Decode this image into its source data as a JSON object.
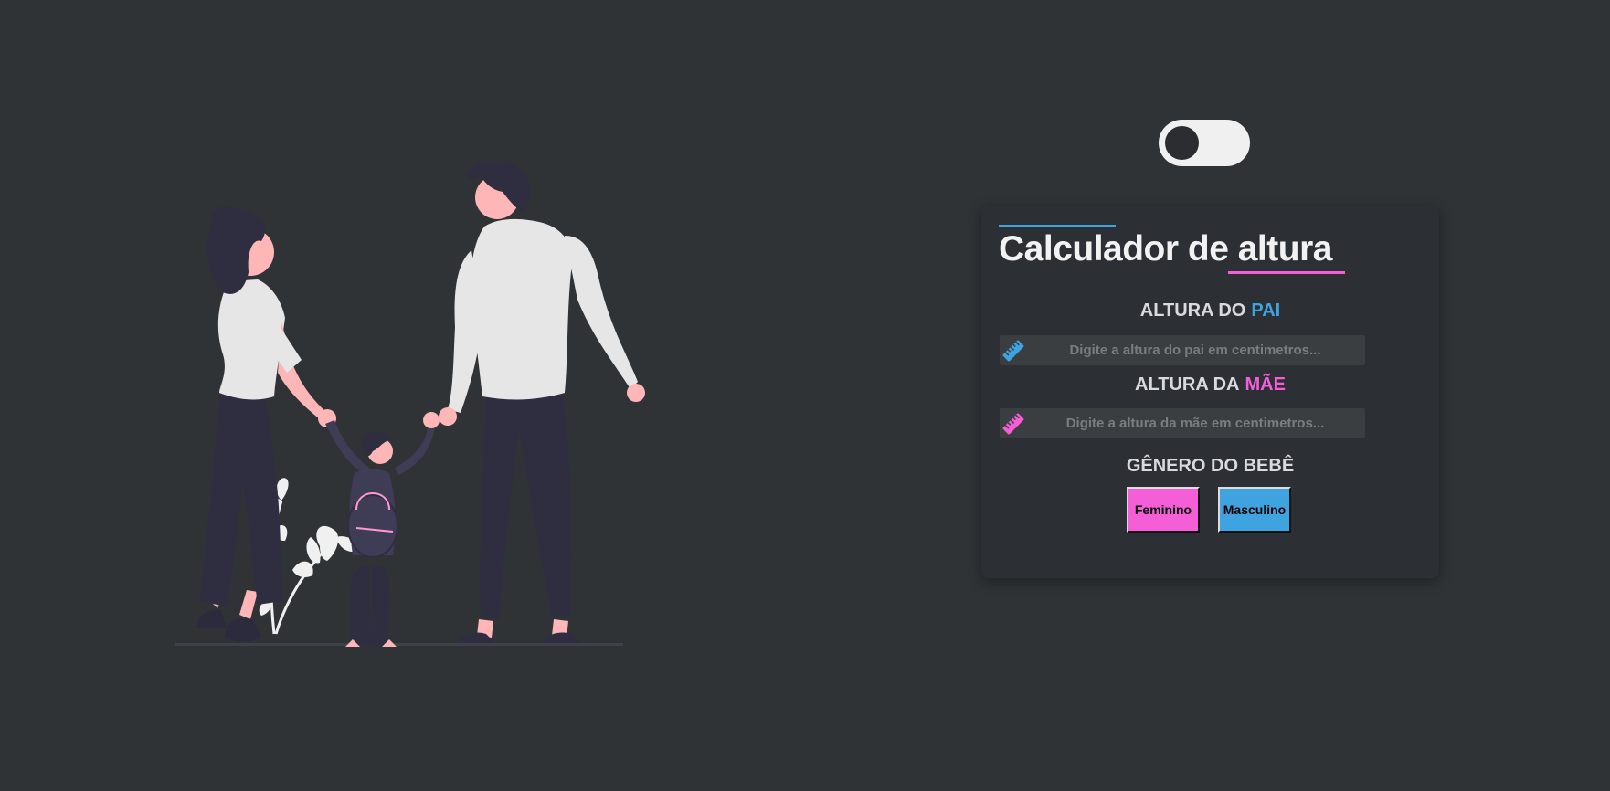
{
  "theme_toggle": {
    "state": "off"
  },
  "card": {
    "title": "Calculador de altura",
    "father": {
      "label_prefix": "ALTURA DO",
      "label_accent": "PAI",
      "placeholder": "Digite a altura do pai em centimetros...",
      "value": "",
      "icon": "ruler-icon"
    },
    "mother": {
      "label_prefix": "ALTURA DA",
      "label_accent": "MÃE",
      "placeholder": "Digite a altura da mãe em centimetros...",
      "value": "",
      "icon": "ruler-icon"
    },
    "gender": {
      "label": "GÊNERO DO BEBÊ",
      "female_label": "Feminino",
      "male_label": "Masculino"
    }
  },
  "colors": {
    "background": "#2f3336",
    "card": "#2c2f33",
    "accent_blue": "#3fa3e0",
    "accent_pink": "#f45fd8"
  }
}
